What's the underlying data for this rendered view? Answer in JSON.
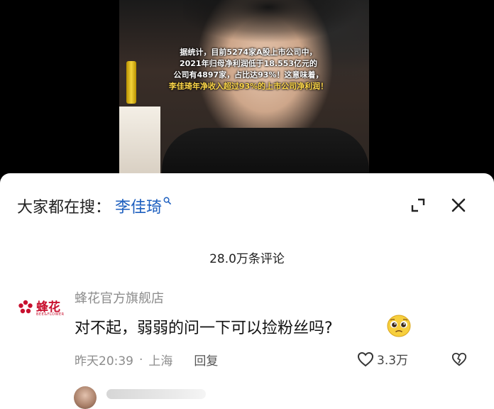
{
  "video": {
    "overlay_lines": [
      "据统计，目前5274家A股上市公司中，",
      "2021年归母净利润低于18.553亿元的",
      "公司有4897家，占比达93%！这意味着，",
      "李佳琦年净收入超过93%的上市公司净利润！"
    ]
  },
  "search_bar": {
    "prefix": "大家都在搜：",
    "keyword": "李佳琦",
    "icon": "search-icon"
  },
  "header_icons": {
    "expand": "expand-icon",
    "close": "close-icon"
  },
  "comments": {
    "count_label": "28.0万条评论",
    "items": [
      {
        "username": "蜂花官方旗舰店",
        "avatar_brand_cn": "蜂花",
        "avatar_brand_en": "BEE&FLOWER",
        "text": "对不起，弱弱的问一下可以捡粉丝吗?",
        "emoji": "pleading-face-emoji",
        "time": "昨天20:39",
        "separator": "·",
        "location": "上海",
        "reply_label": "回复",
        "like_count": "3.3万"
      }
    ]
  },
  "colors": {
    "keyword": "#1d5fbf",
    "brand": "#c8102e",
    "meta_gray": "#8c8c8c"
  }
}
